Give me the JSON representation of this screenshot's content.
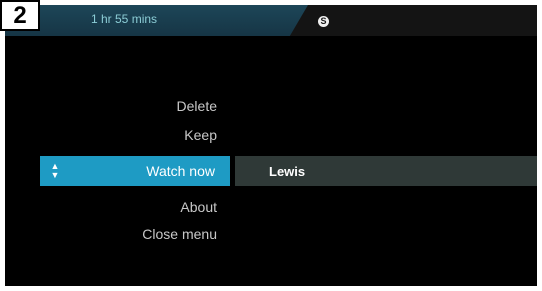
{
  "step_badge": "2",
  "header": {
    "duration": "1 hr 55 mins",
    "subtitle_icon": "S"
  },
  "menu": {
    "items": [
      "Delete",
      "Keep",
      "Watch now",
      "About",
      "Close menu"
    ],
    "selected_index": 2,
    "selected_label": "Watch now"
  },
  "profile": {
    "name": "Lewis"
  },
  "colors": {
    "accent": "#1e9bc4",
    "header_teal": "#1d4658",
    "profile_bar": "#2f3937",
    "background": "#000000"
  },
  "icons": {
    "selector": "up-down-arrows-icon",
    "subtitles": "subtitles-icon"
  }
}
